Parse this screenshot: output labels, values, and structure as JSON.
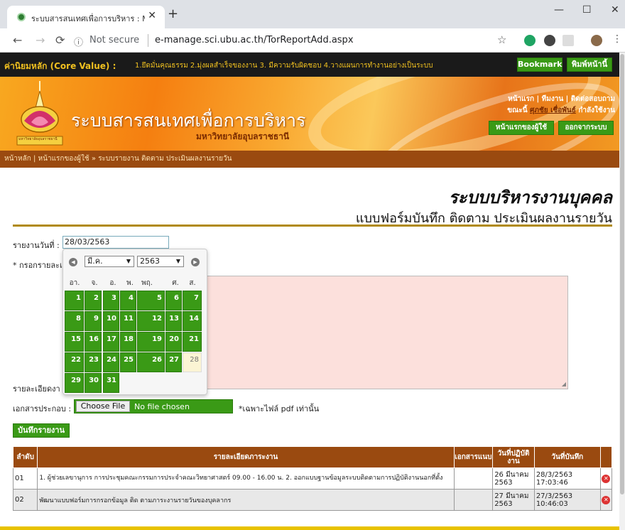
{
  "browser": {
    "tab_title": "ระบบสารสนเทศเพื่อการบริหาร : Mana",
    "tab_close": "✕",
    "new_tab": "+",
    "win_minimize": "—",
    "win_maximize": "☐",
    "win_close": "✕",
    "not_secure": "Not secure",
    "url": "e-manage.sci.ubu.ac.th/TorReportAdd.aspx"
  },
  "core_bar": {
    "label": "ค่านิยมหลัก (Core Value) :",
    "text": "1.ยึดมั่นคุณธรรม 2.มุ่งผลสำเร็จของงาน 3. มีความรับผิดชอบ 4.วางแผนการทำงานอย่างเป็นระบบ",
    "bookmark": "Bookmark",
    "print": "พิมพ์หน้านี้"
  },
  "header": {
    "logo_caption": "มหาวิทยาลัยอุบลราชธานี",
    "title": "ระบบสารสนเทศเพื่อการบริหาร",
    "subtitle": "มหาวิทยาลัยอุบลราชธานี",
    "links": "หน้าแรก | ทีมงาน | ติดต่อสอบถาม",
    "now_prefix": "ขณะนี้",
    "user": "ศุภชัย เชื่อพันธ์",
    "now_suffix": "กำลังใช้งาน",
    "user_home": "หน้าแรกของผู้ใช้",
    "logout": "ออกจากระบบ"
  },
  "breadcrumb": "หน้าหลัก | หน้าแรกของผู้ใช้ » ระบบรายงาน ติดตาม ประเมินผลงานรายวัน",
  "page": {
    "heading": "ระบบบริหารงานบุคคล",
    "subheading": "แบบฟอร์มบันทึก ติดตาม ประเมินผลงานรายวัน"
  },
  "form": {
    "date_label": "รายงานวันที่ :",
    "date_value": "28/03/2563",
    "fill_label": "* กรอกรายละเ",
    "detail_label": "รายละเอียดงา",
    "attach_label": "เอกสารประกอบ :",
    "choose_file": "Choose File",
    "no_file": "No file chosen",
    "pdf_note": "*เฉพาะไฟล์ pdf เท่านั้น",
    "submit": "บันทึกรายงาน"
  },
  "calendar": {
    "month": "มี.ค.",
    "year": "2563",
    "prev": "◀",
    "next": "▶",
    "weekdays": [
      "อา.",
      "จ.",
      "อ.",
      "พ.",
      "พฤ.",
      "ศ.",
      "ส."
    ],
    "days": [
      "1",
      "2",
      "3",
      "4",
      "5",
      "6",
      "7",
      "8",
      "9",
      "10",
      "11",
      "12",
      "13",
      "14",
      "15",
      "16",
      "17",
      "18",
      "19",
      "20",
      "21",
      "22",
      "23",
      "24",
      "25",
      "26",
      "27",
      "28",
      "29",
      "30",
      "31"
    ]
  },
  "table": {
    "headers": [
      "ลำดับ",
      "รายละเอียดภาระงาน",
      "เอกสารแนบ",
      "วันที่ปฏิบัติงาน",
      "วันที่บันทึก"
    ],
    "rows": [
      {
        "no": "01",
        "detail": "1. ผู้ช่วยเลขานุการ การประชุมคณะกรรมการประจำคณะวิทยาศาสตร์ 09.00 - 16.00 น. 2. ออกแบบฐานข้อมูลระบบติดตามการปฏิบัติงานนอกที่ตั้ง",
        "attach": "",
        "work_date": "26 มีนาคม 2563",
        "record_date": "28/3/2563 17:03:46"
      },
      {
        "no": "02",
        "detail": "พัฒนาแบบฟอร์มการกรอกข้อมูล ติด ตามภาระงานรายวันของบุคลากร",
        "attach": "",
        "work_date": "27 มีนาคม 2563",
        "record_date": "27/3/2563 10:46:03"
      }
    ]
  },
  "colors": {
    "green": "#3a9a16",
    "brown": "#9a4a10",
    "orange": "#f57f10",
    "gold": "#f0c020"
  }
}
